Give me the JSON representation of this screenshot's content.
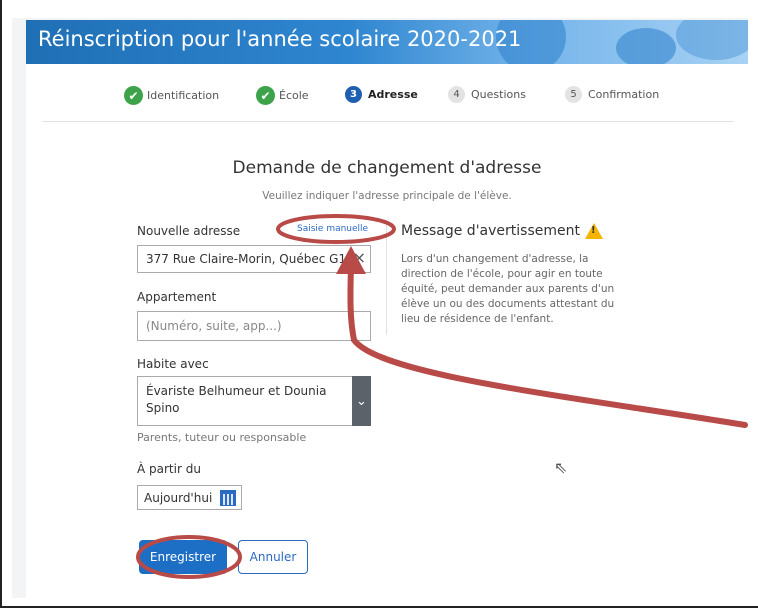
{
  "header": {
    "title": "Réinscription pour l'année scolaire 2020-2021"
  },
  "stepper": {
    "steps": [
      {
        "label": "Identification",
        "marker": "✔",
        "state": "done"
      },
      {
        "label": "École",
        "marker": "✔",
        "state": "done"
      },
      {
        "label": "Adresse",
        "marker": "3",
        "state": "current"
      },
      {
        "label": "Questions",
        "marker": "4",
        "state": "pending"
      },
      {
        "label": "Confirmation",
        "marker": "5",
        "state": "pending"
      }
    ]
  },
  "form": {
    "title": "Demande de changement d'adresse",
    "subtitle": "Veuillez indiquer l'adresse principale de l'élève.",
    "address": {
      "label": "Nouvelle adresse",
      "manual_link": "Saisie manuelle",
      "value": "377  Rue Claire-Morin, Québec G1",
      "clear_symbol": "×"
    },
    "apartment": {
      "label": "Appartement",
      "placeholder": "(Numéro, suite, app...)"
    },
    "lives_with": {
      "label": "Habite avec",
      "value": "Évariste Belhumeur et Dounia Spino",
      "help": "Parents, tuteur ou responsable",
      "arrow": "⌄"
    },
    "start_date": {
      "label": "À partir du",
      "value": "Aujourd'hui"
    },
    "buttons": {
      "save": "Enregistrer",
      "cancel": "Annuler"
    }
  },
  "warning": {
    "title": "Message d'avertissement",
    "icon_glyph": "!",
    "text": "Lors d'un changement d'adresse, la direction de l'école, pour agir en toute équité, peut demander aux parents d'un élève un ou des documents attestant du lieu de résidence de l'enfant."
  },
  "annotation": {
    "color": "#b84a48"
  },
  "colors": {
    "primary": "#1d6ec5",
    "success": "#3da34a",
    "warning": "#f4b400",
    "header": "#1f6fb5"
  },
  "icons": [
    "check-icon",
    "warning-icon",
    "calendar-icon",
    "chevron-down-icon",
    "clear-icon",
    "mouse-cursor-icon"
  ]
}
